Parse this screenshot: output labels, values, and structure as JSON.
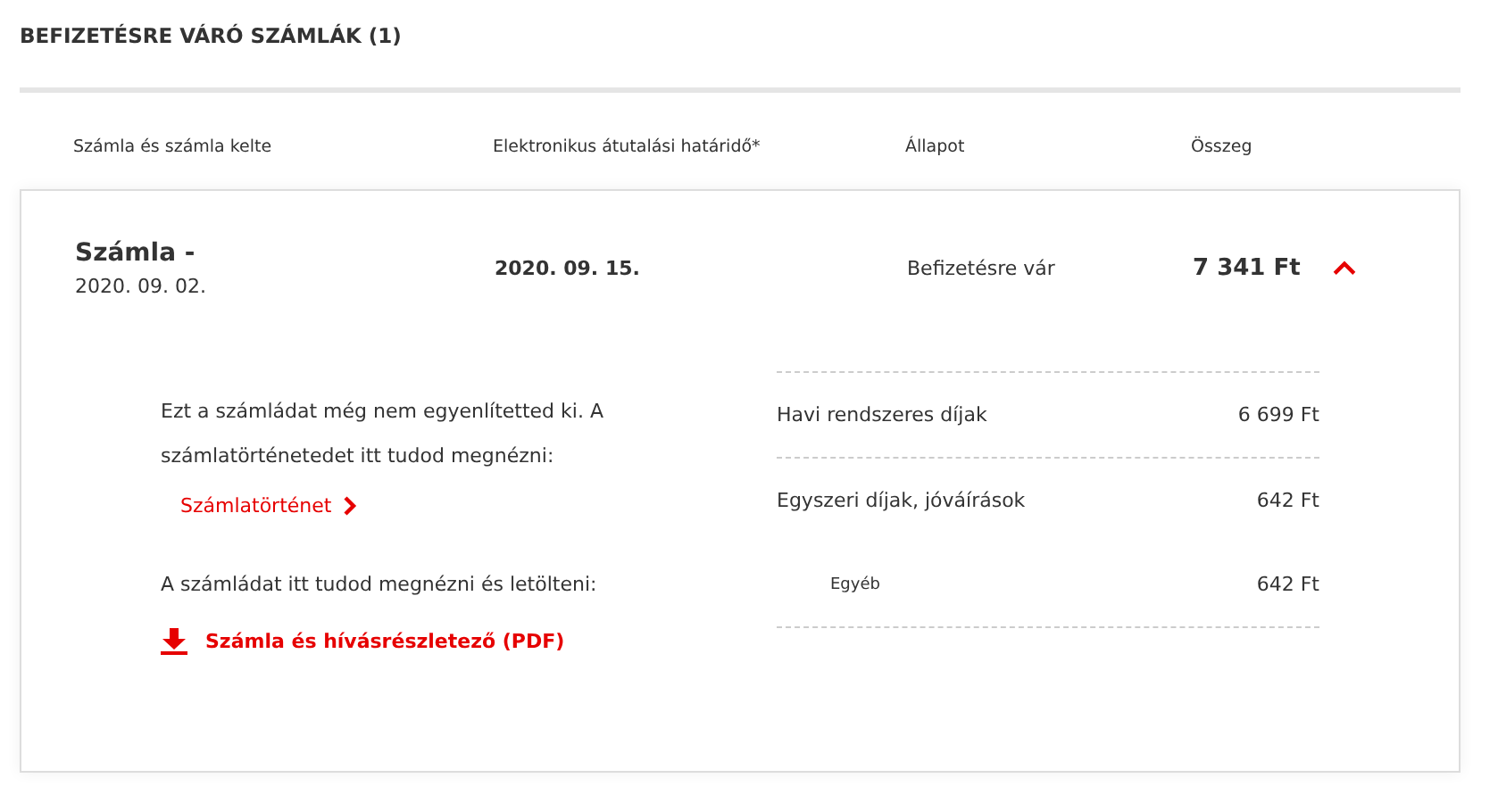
{
  "section_title": "BEFIZETÉSRE VÁRÓ SZÁMLÁK (1)",
  "columns": [
    "Számla és számla kelte",
    "Elektronikus átutalási határidő*",
    "Állapot",
    "Összeg"
  ],
  "invoices": [
    {
      "title": "Számla -",
      "date": "2020. 09. 02.",
      "due": "2020. 09. 15.",
      "status": "Befizetésre vár",
      "amount": "7 341 Ft",
      "expanded": true,
      "notice": "Ezt a számládat még nem egyenlítetted ki. A számlatörténetedet itt tudod megnézni:",
      "history_link": "Számlatörténet",
      "download_text": "A számládat itt tudod megnézni és letölteni:",
      "download_link": "Számla és hívásrészletező (PDF)",
      "charges": [
        {
          "kind": "main",
          "label": "Havi rendszeres díjak",
          "amount": "6 699 Ft"
        },
        {
          "kind": "main",
          "label": "Egyszeri díjak, jóváírások",
          "amount": "642 Ft"
        },
        {
          "kind": "sub",
          "label": "Egyéb",
          "amount": "642 Ft"
        }
      ]
    }
  ]
}
